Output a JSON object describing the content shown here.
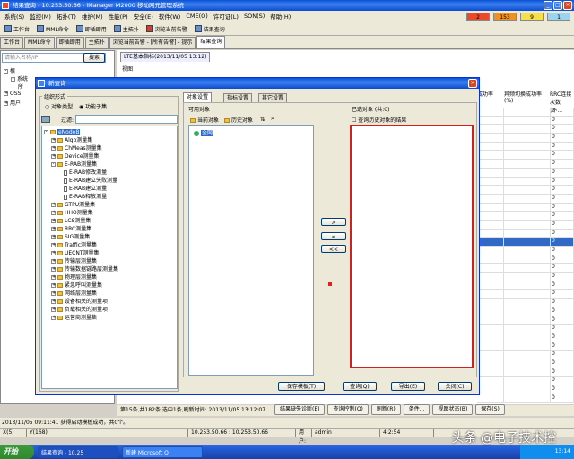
{
  "window": {
    "title": "结果查询 - 10.253.50.66 - iManager M2000 移动网元管理系统",
    "min": "_",
    "max": "□",
    "close": "×"
  },
  "menu": [
    "系统(S)",
    "监控(M)",
    "拓扑(T)",
    "维护(M)",
    "性能(P)",
    "安全(E)",
    "软件(W)",
    "CME(O)",
    "许可证(L)",
    "SON(S)",
    "帮助(H)"
  ],
  "alarms": [
    {
      "value": "2",
      "color": "#e84a2a"
    },
    {
      "value": "153",
      "color": "#f09020"
    },
    {
      "value": "9",
      "color": "#f5e04a"
    },
    {
      "value": "1",
      "color": "#9ad4f0"
    }
  ],
  "toolbar": [
    "工作台",
    "MML命令",
    "即插即用",
    "主拓扑",
    "浏览当前告警",
    "结果查询"
  ],
  "tabs": [
    "工作台",
    "MML命令",
    "即插即用",
    "主拓扑",
    "浏览当前告警 - [所有告警] - 提示",
    "结果查询"
  ],
  "left": {
    "search_placeholder": "请输入名称/IP",
    "search_btn": "搜索",
    "tree": [
      "根",
      "系统",
      "所",
      "OSS",
      "用户"
    ]
  },
  "right": {
    "subtab": "LTE基本指标(2013/11/05 13:12)",
    "view_label": "视图",
    "cols": [
      "成功率",
      "异频切换成功率(%)",
      "RRC连接次数(不..."
    ]
  },
  "grid_zero": "0",
  "status": {
    "summary": "第15条,共182条,选中1条,刷新时间: 2013/11/05 13:12:07",
    "buttons": [
      "结果缺失诊断(E)",
      "查询控制(Q)",
      "刷新(R)",
      "条件...",
      "视图状态(B)",
      "保存(S)"
    ],
    "log": "2013/11/05 09:11:41 获得启动模板成功，共0个。",
    "x": "X(5)",
    "y": "Y(168)",
    "ip": "10.253.50.66 : 10.253.50.66",
    "user_label": "用户:",
    "user": "admin",
    "time": "4:2:54"
  },
  "taskbar": {
    "start": "开始",
    "tasks": [
      "结果查询 - 10.25",
      "新建 Microsoft O"
    ],
    "clock": "13:14"
  },
  "dialog": {
    "title": "新查询",
    "org_group": "组织形式",
    "radio_object": "对象类型",
    "radio_func": "功能子集",
    "filter_label": "过滤:",
    "tree_root": "eNodeB",
    "tree_items": [
      "Algo测量集",
      "ChMeas测量集",
      "Device测量集",
      "E-RAB测量集",
      "E-RAB修改测量",
      "E-RAB建立失败测量",
      "E-RAB建立测量",
      "E-RAB释放测量",
      "GTPU测量集",
      "HHO测量集",
      "LCS测量集",
      "RRC测量集",
      "SIG测量集",
      "Traffic测量集",
      "UECNT测量集",
      "传输层测量集",
      "传输数据链路层测量集",
      "物理层测量集",
      "紧急呼叫测量集",
      "网络层测量集",
      "设备相关的测量项",
      "负载相关的测量项",
      "运营商测量集"
    ],
    "tabs": [
      "对象设置",
      "指标设置",
      "其它设置"
    ],
    "available_label": "可用对象",
    "current_btn": "当前对象",
    "history_btn": "历史对象",
    "obj_root": "全网",
    "selected_label": "已选对象 (共:0)",
    "history_check": "查询历史对象的结果",
    "arrows": [
      ">",
      "<",
      "<<"
    ],
    "buttons": [
      "保存模板(T)",
      "查询(Q)",
      "导出(E)",
      "关闭(C)"
    ]
  },
  "watermark": "头条 @电子技术控"
}
